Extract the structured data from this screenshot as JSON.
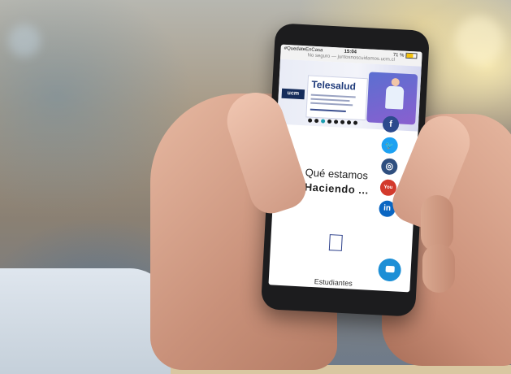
{
  "status_bar": {
    "carrier": "#QuedateEnCasa",
    "time": "15:04",
    "battery": "71 %",
    "url": "No seguro — juntosnoscuidamos.ucm.cl"
  },
  "banner": {
    "logo": "ucm",
    "title": "Telesalud"
  },
  "content": {
    "heading_line1": "Qué estamos",
    "heading_line2": "Haciendo ...",
    "bottom_label": "Estudiantes"
  },
  "social_icons": [
    "facebook-icon",
    "twitter-icon",
    "instagram-icon",
    "youtube-icon",
    "linkedin-icon"
  ],
  "social_glyphs": {
    "facebook": "f",
    "twitter": "🐦",
    "instagram": "◎",
    "youtube": "You",
    "linkedin": "in"
  },
  "colors": {
    "ucm_navy": "#152c5b",
    "facebook": "#2c4a8d",
    "twitter": "#1da1f2",
    "youtube": "#d33a2c",
    "linkedin": "#0a66c2",
    "chat": "#1d8fd6"
  }
}
